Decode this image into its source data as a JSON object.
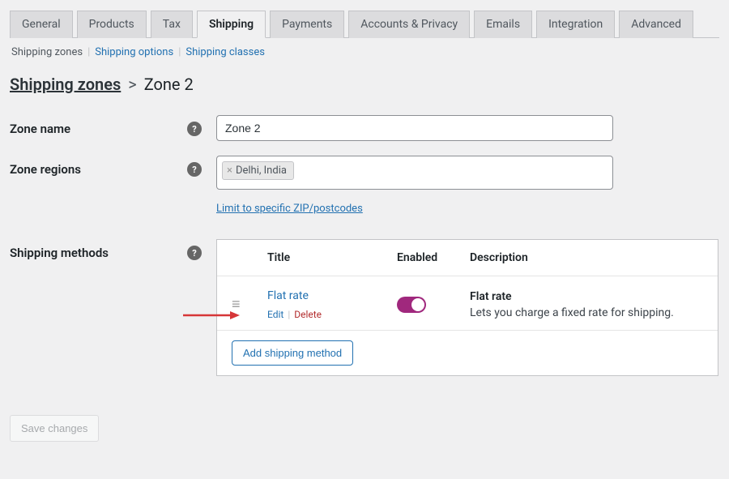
{
  "tabs": [
    "General",
    "Products",
    "Tax",
    "Shipping",
    "Payments",
    "Accounts & Privacy",
    "Emails",
    "Integration",
    "Advanced"
  ],
  "active_tab_index": 3,
  "subtabs": {
    "zones": "Shipping zones",
    "options": "Shipping options",
    "classes": "Shipping classes"
  },
  "breadcrumb": {
    "parent": "Shipping zones",
    "current": "Zone 2"
  },
  "labels": {
    "zone_name": "Zone name",
    "zone_regions": "Zone regions",
    "shipping_methods": "Shipping methods",
    "zip_link": "Limit to specific ZIP/postcodes"
  },
  "zone_name_value": "Zone 2",
  "region_tag": "Delhi, India",
  "methods_table": {
    "headers": {
      "title": "Title",
      "enabled": "Enabled",
      "description": "Description"
    },
    "row": {
      "title": "Flat rate",
      "enabled": true,
      "desc_title": "Flat rate",
      "desc_text": "Lets you charge a fixed rate for shipping.",
      "edit": "Edit",
      "delete": "Delete"
    },
    "add_button": "Add shipping method"
  },
  "save_button": "Save changes"
}
